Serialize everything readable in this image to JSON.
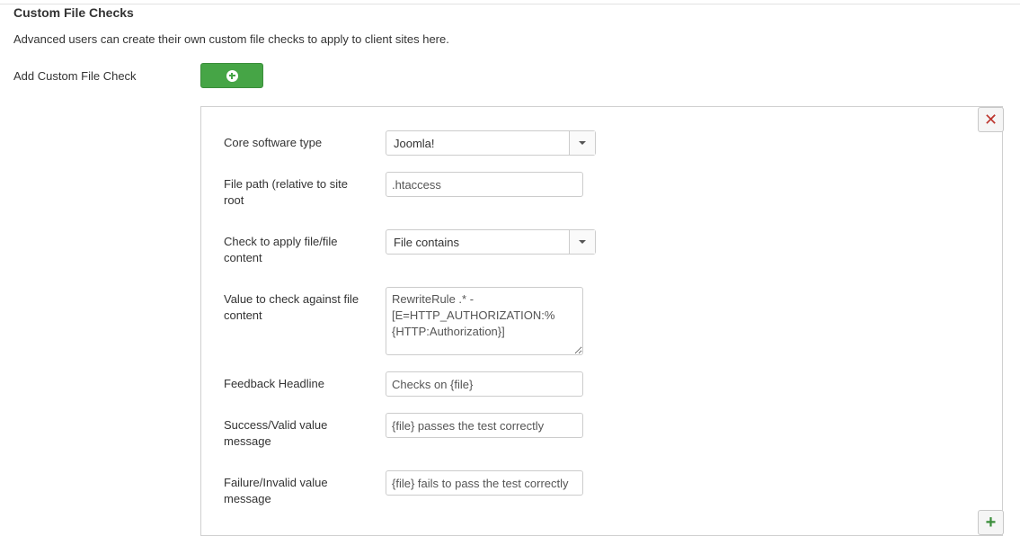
{
  "section": {
    "title": "Custom File Checks",
    "intro": "Advanced users can create their own custom file checks to apply to client sites here.",
    "add_label": "Add Custom File Check"
  },
  "icons": {
    "add": "plus-circle-icon",
    "remove": "close-icon",
    "add_row": "plus-icon"
  },
  "colors": {
    "add_button": "#46a546",
    "remove_icon": "#bd362f",
    "add_row_icon": "#3b8e3b"
  },
  "form": {
    "core_type": {
      "label": "Core software type",
      "value": "Joomla!"
    },
    "file_path": {
      "label": "File path (relative to site root",
      "value": ".htaccess"
    },
    "check_type": {
      "label": "Check to apply file/file content",
      "value": "File contains"
    },
    "check_value": {
      "label": "Value to check against file content",
      "value": "RewriteRule .* - [E=HTTP_AUTHORIZATION:%{HTTP:Authorization}]"
    },
    "headline": {
      "label": "Feedback Headline",
      "value": "Checks on {file}"
    },
    "success": {
      "label": "Success/Valid value message",
      "value": "{file} passes the test correctly"
    },
    "failure": {
      "label": "Failure/Invalid value message",
      "value": "{file} fails to pass the test correctly"
    }
  }
}
